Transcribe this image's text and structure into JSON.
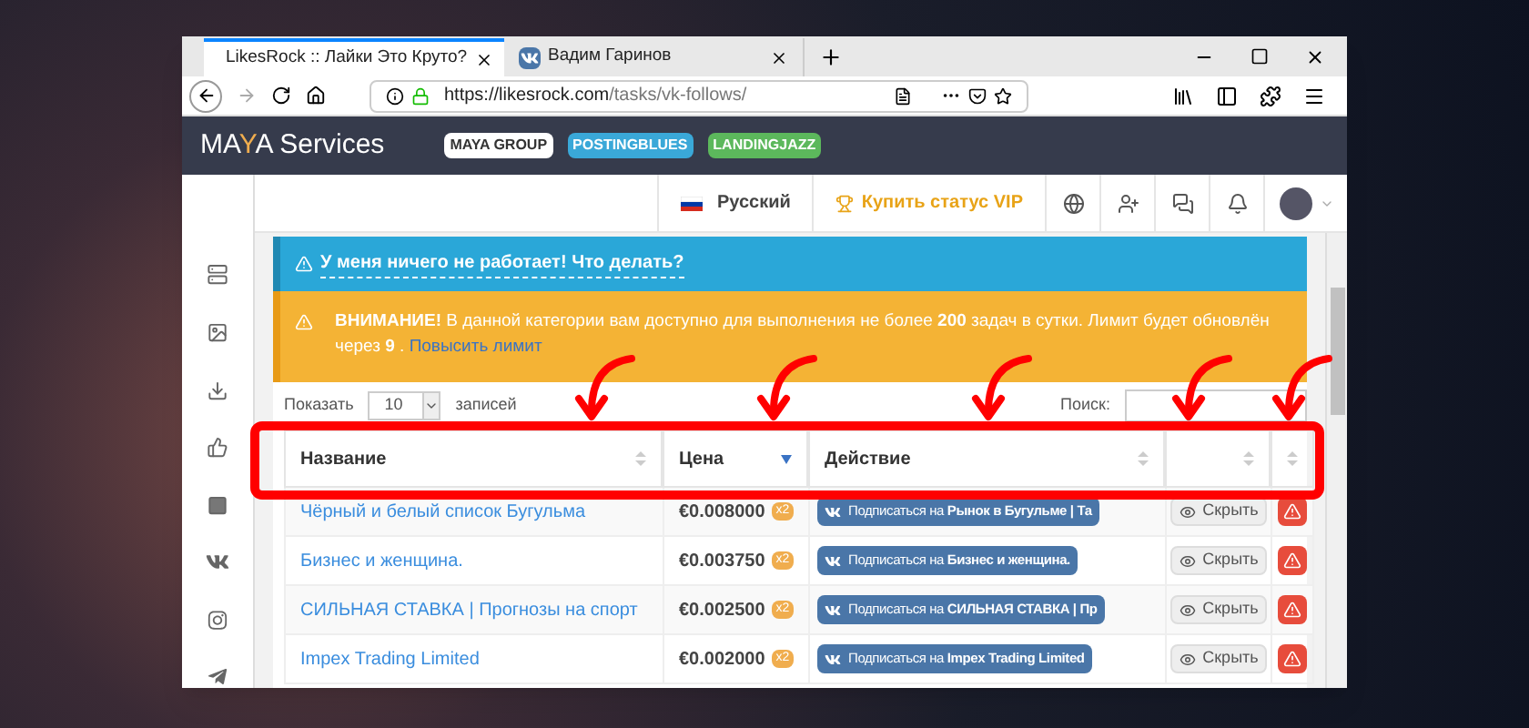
{
  "browser": {
    "tabs": [
      {
        "title": "LikesRock :: Лайки Это Круто?",
        "selected": true,
        "kind": "site"
      },
      {
        "title": "Вадим Гаринов",
        "selected": false,
        "kind": "vk"
      }
    ],
    "url": {
      "host": "https://likesrock.com",
      "path": "/tasks/vk-follows/"
    }
  },
  "navbar": {
    "logo": [
      {
        "text": "MA",
        "accent": false
      },
      {
        "text": "Y",
        "accent": true
      },
      {
        "text": "A",
        "accent": false
      }
    ],
    "logo_suffix": "Services",
    "badges": [
      {
        "label": "MAYA GROUP",
        "color": "#ffffff"
      },
      {
        "label": "POSTINGBLUES",
        "color": "#3aa8d8"
      },
      {
        "label": "LANDINGJAZZ",
        "color": "#5cb85c"
      }
    ]
  },
  "topbar": {
    "language": "Русский",
    "vip": "Купить статус VIP"
  },
  "info_alert": "У меня ничего не работает! Что делать?",
  "warning_alert": {
    "text": "**ВНИМАНИЕ!** В данной категории вам доступно для выполнения не более **200** задач в сутки. Лимит будет обновлён через **9** .",
    "link": "Повысить лимит"
  },
  "table_controls": {
    "show_label": "Показать",
    "page_size": "10",
    "entries_label": "записей",
    "search_label": "Поиск:"
  },
  "table": {
    "columns": [
      {
        "label": "Название",
        "sorted": false
      },
      {
        "label": "Цена",
        "sorted": true
      },
      {
        "label": "Действие",
        "sorted": false
      },
      {
        "sorted": false
      },
      {
        "sorted": false
      }
    ],
    "rows": [
      {
        "name": "Чёрный и белый список Бугульма",
        "price": "€0.008000",
        "multiplier": "x2",
        "action": "Подписаться на **Рынок в Бугульме | Та**",
        "hide": "Скрыть"
      },
      {
        "name": "Бизнес и женщина.",
        "price": "€0.003750",
        "multiplier": "x2",
        "action": "Подписаться на **Бизнес и женщина.**",
        "hide": "Скрыть"
      },
      {
        "name": "СИЛЬНАЯ СТАВКА | Прогнозы на спорт",
        "price": "€0.002500",
        "multiplier": "x2",
        "action": "Подписаться на **СИЛЬНАЯ СТАВКА | Пр**",
        "hide": "Скрыть"
      },
      {
        "name": "Impex Trading Limited",
        "price": "€0.002000",
        "multiplier": "x2",
        "action": "Подписаться на **Impex Trading Limited**",
        "hide": "Скрыть"
      }
    ]
  }
}
